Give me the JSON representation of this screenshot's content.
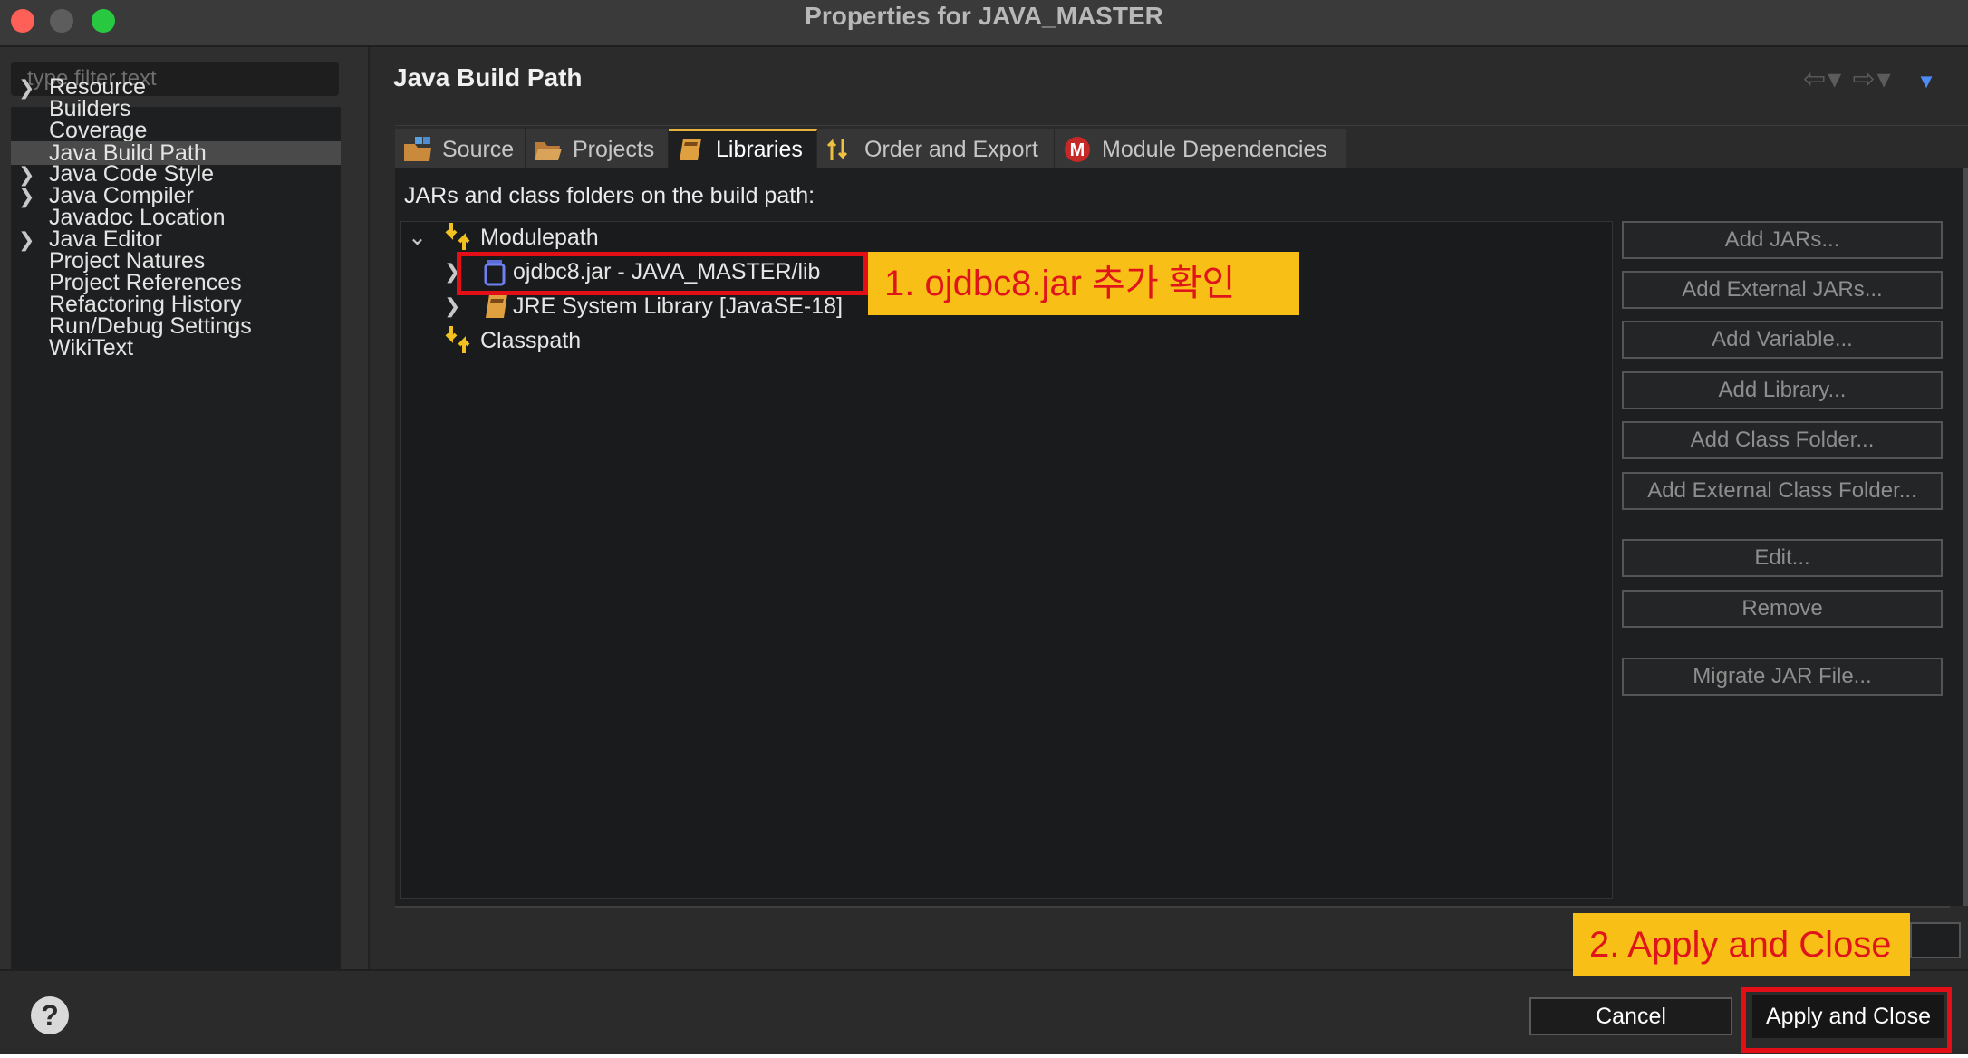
{
  "window": {
    "title": "Properties for JAVA_MASTER"
  },
  "filter": {
    "placeholder": "type filter text"
  },
  "sidebar": {
    "items": [
      {
        "label": "Resource",
        "expandable": true,
        "selected": false
      },
      {
        "label": "Builders",
        "expandable": false,
        "selected": false
      },
      {
        "label": "Coverage",
        "expandable": false,
        "selected": false
      },
      {
        "label": "Java Build Path",
        "expandable": false,
        "selected": true
      },
      {
        "label": "Java Code Style",
        "expandable": true,
        "selected": false
      },
      {
        "label": "Java Compiler",
        "expandable": true,
        "selected": false
      },
      {
        "label": "Javadoc Location",
        "expandable": false,
        "selected": false
      },
      {
        "label": "Java Editor",
        "expandable": true,
        "selected": false
      },
      {
        "label": "Project Natures",
        "expandable": false,
        "selected": false
      },
      {
        "label": "Project References",
        "expandable": false,
        "selected": false
      },
      {
        "label": "Refactoring History",
        "expandable": false,
        "selected": false
      },
      {
        "label": "Run/Debug Settings",
        "expandable": false,
        "selected": false
      },
      {
        "label": "WikiText",
        "expandable": false,
        "selected": false
      }
    ]
  },
  "page": {
    "title": "Java Build Path"
  },
  "tabs": [
    {
      "label": "Source",
      "active": false
    },
    {
      "label": "Projects",
      "active": false
    },
    {
      "label": "Libraries",
      "active": true
    },
    {
      "label": "Order and Export",
      "active": false
    },
    {
      "label": "Module Dependencies",
      "active": false
    }
  ],
  "libraries": {
    "caption": "JARs and class folders on the build path:",
    "tree": {
      "modulepath": "Modulepath",
      "jar": "ojdbc8.jar - JAVA_MASTER/lib",
      "jre": "JRE System Library [JavaSE-18]",
      "classpath": "Classpath"
    },
    "buttons": [
      "Add JARs...",
      "Add External JARs...",
      "Add Variable...",
      "Add Library...",
      "Add Class Folder...",
      "Add External Class Folder...",
      "Edit...",
      "Remove",
      "Migrate JAR File..."
    ]
  },
  "footer": {
    "help": "?",
    "cancel": "Cancel",
    "apply_close": "Apply and Close"
  },
  "annotations": {
    "note1": "1. ojdbc8.jar  추가 확인",
    "note2": "2. Apply and Close"
  },
  "colors": {
    "annotation_red": "#e30e16",
    "annotation_yellow": "#f8c016",
    "tab_accent": "#e8b13a",
    "nav_dropdown": "#4d8cf5"
  },
  "icons": {
    "source_tab": "package-icon",
    "projects_tab": "folder-icon",
    "libraries_tab": "book-icon",
    "order_tab": "sort-arrows-icon",
    "module_tab": "module-m-icon",
    "modulepath": "path-arrows-icon",
    "jar": "jar-icon",
    "jre": "library-book-icon"
  }
}
